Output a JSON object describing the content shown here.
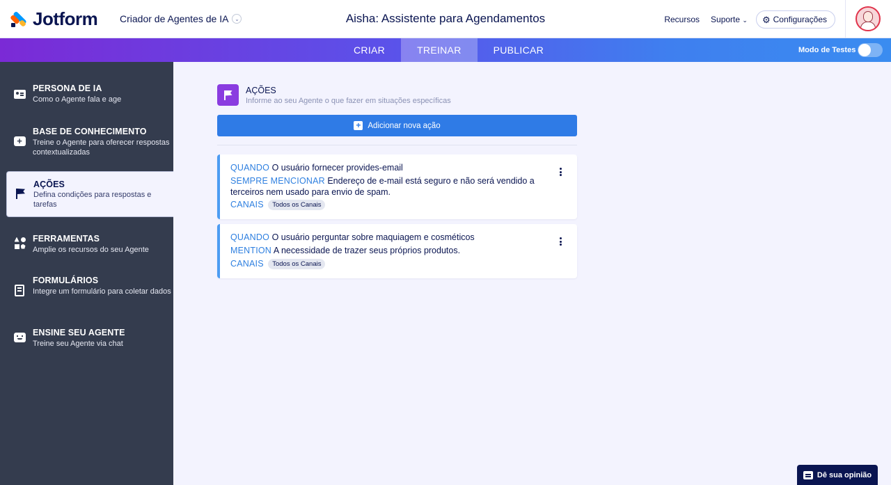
{
  "header": {
    "logo_text": "Jotform",
    "product_name": "Criador de Agentes de IA",
    "agent_title": "Aisha: Assistente para Agendamentos",
    "links": {
      "resources": "Recursos",
      "support": "Suporte",
      "settings": "Configurações"
    }
  },
  "nav": {
    "tabs": [
      {
        "label": "CRIAR"
      },
      {
        "label": "TREINAR"
      },
      {
        "label": "PUBLICAR"
      }
    ],
    "active_tab": "TREINAR",
    "test_mode_label": "Modo de Testes",
    "test_mode_enabled": false
  },
  "sidebar": {
    "items": [
      {
        "title": "PERSONA DE IA",
        "subtitle": "Como o Agente fala e age",
        "icon": "id-card-icon"
      },
      {
        "title": "BASE DE CONHECIMENTO",
        "subtitle": "Treine o Agente para oferecer respostas contextualizadas",
        "icon": "chat-plus-icon"
      },
      {
        "title": "AÇÕES",
        "subtitle": "Defina condições para respostas e tarefas",
        "icon": "flag-icon"
      },
      {
        "title": "FERRAMENTAS",
        "subtitle": "Amplie os recursos do seu Agente",
        "icon": "shapes-icon"
      },
      {
        "title": "FORMULÁRIOS",
        "subtitle": "Integre um formulário para coletar dados",
        "icon": "form-icon"
      },
      {
        "title": "ENSINE SEU AGENTE",
        "subtitle": "Treine seu Agente via chat",
        "icon": "bot-chat-icon"
      }
    ],
    "active_item": "AÇÕES"
  },
  "main": {
    "section_title": "AÇÕES",
    "section_subtitle": "Informe ao seu Agente o que fazer em situações específicas",
    "add_button": "Adicionar nova ação",
    "actions": [
      {
        "when_kw": "QUANDO",
        "when": "O usuário fornecer provides-email",
        "do_kw": "SEMPRE MENCIONAR",
        "do": "Endereço de e-mail está seguro e não será vendido a terceiros nem usado para envio de spam.",
        "channels_kw": "CANAIS",
        "channels": "Todos os Canais"
      },
      {
        "when_kw": "QUANDO",
        "when": "O usuário perguntar sobre maquiagem e cosméticos",
        "do_kw": "MENTION",
        "do": "A necessidade de trazer seus próprios produtos.",
        "channels_kw": "CANAIS",
        "channels": "Todos os Canais"
      }
    ]
  },
  "feedback_button": "Dê sua opinião",
  "colors": {
    "brand_navy": "#0a1551",
    "sidebar_bg": "#343c4e",
    "primary_blue": "#2f7be6",
    "keyword_blue": "#2f80e0",
    "actions_purple": "#8a3ce0"
  }
}
